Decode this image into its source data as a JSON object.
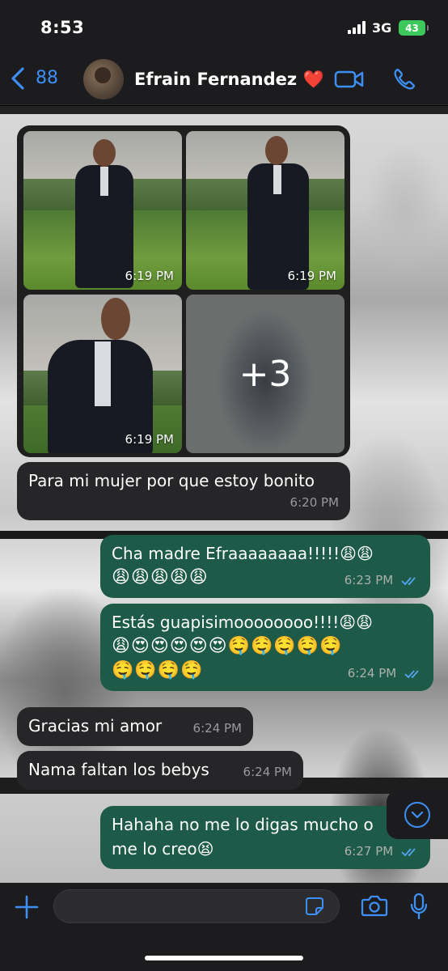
{
  "status_bar": {
    "time": "8:53",
    "network": "3G",
    "battery": "43"
  },
  "header": {
    "back_count": "88",
    "contact_name": "Efrain Fernandez ❤️"
  },
  "album": {
    "photos": [
      {
        "time": "6:19 PM"
      },
      {
        "time": "6:19 PM"
      },
      {
        "time": "6:19 PM"
      }
    ],
    "more_count": "+3"
  },
  "messages": [
    {
      "direction": "incoming",
      "text": "Para mi mujer por que estoy bonito",
      "time": "6:20 PM"
    },
    {
      "direction": "outgoing",
      "text": "Cha madre Efraaaaaaaa!!!!!😩😩",
      "text2": "😩😩😩😩😩",
      "time": "6:23 PM",
      "read": true
    },
    {
      "direction": "outgoing",
      "text": "Estás guapisimoooooooo!!!!😩😩",
      "text2": "😩😍😍😍😍😍🤤🤤🤤🤤🤤",
      "text3": "🤤🤤🤤🤤",
      "time": "6:24 PM",
      "read": true
    },
    {
      "direction": "incoming",
      "text": "Gracias mi amor",
      "time": "6:24 PM"
    },
    {
      "direction": "incoming",
      "text": "Nama faltan los bebys",
      "time": "6:24 PM"
    },
    {
      "direction": "outgoing",
      "text": "Hahaha no me lo digas mucho o",
      "text2": "me lo creo😫",
      "time": "6:27 PM",
      "read": true
    }
  ],
  "input": {
    "value": "",
    "placeholder": ""
  },
  "colors": {
    "accent": "#3d8ff5",
    "outgoing_bubble": "#1d5a48",
    "incoming_bubble": "#262628",
    "battery": "#3cc85a"
  }
}
